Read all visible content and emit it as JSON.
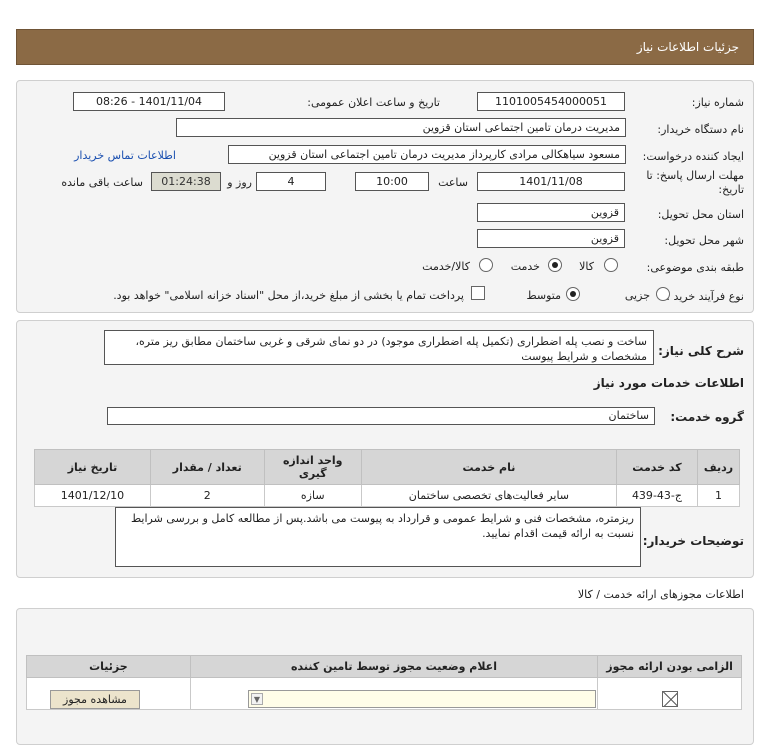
{
  "header": {
    "title": "جزئیات اطلاعات نیاز"
  },
  "need": {
    "number_label": "شماره نیاز:",
    "number": "1101005454000051",
    "announce_label": "تاریخ و ساعت اعلان عمومی:",
    "announce_value": "1401/11/04 - 08:26",
    "buyer_label": "نام دستگاه خریدار:",
    "buyer_value": "مدیریت درمان تامین اجتماعی استان قزوین",
    "creator_label": "ایجاد کننده درخواست:",
    "creator_value": "مسعود سیاهکالی مرادی کارپرداز مدیریت درمان تامین اجتماعی استان قزوین",
    "contact_link": "اطلاعات تماس خریدار",
    "deadline_label_1": "مهلت ارسال پاسخ: تا",
    "deadline_label_2": "تاریخ:",
    "deadline_date": "1401/11/08",
    "time_label": "ساعت",
    "deadline_time": "10:00",
    "days_value": "4",
    "days_label": "روز و",
    "remaining_time": "01:24:38",
    "remaining_label": "ساعت باقی مانده",
    "province_label": "استان محل تحویل:",
    "province_value": "قزوین",
    "city_label": "شهر محل تحویل:",
    "city_value": "قزوین",
    "category_label": "طبقه بندی موضوعی:",
    "category_options": [
      "کالا",
      "خدمت",
      "کالا/خدمت"
    ],
    "category_selected": 1,
    "process_label": "نوع فرآیند خرید :",
    "process_options": [
      "جزیی",
      "متوسط"
    ],
    "process_selected": 1,
    "payment_note": "پرداخت تمام یا بخشی از مبلغ خرید،از محل \"اسناد خزانه اسلامی\" خواهد بود."
  },
  "details": {
    "description_label": "شرح کلی نیاز:",
    "description": "ساخت و نصب پله اضطراری (تکمیل پله اضطراری موجود) در دو نمای شرقی و غربی ساختمان مطابق ریز متره، مشخصات و شرایط پیوست",
    "services_title": "اطلاعات خدمات مورد نیاز",
    "service_group_label": "گروه خدمت:",
    "service_group_value": "ساختمان",
    "table": {
      "headers": [
        "ردیف",
        "کد خدمت",
        "نام خدمت",
        "واحد اندازه گیری",
        "تعداد / مقدار",
        "تاریخ نیاز"
      ],
      "rows": [
        [
          "1",
          "ج-43-439",
          "سایر فعالیت‌های تخصصی ساختمان",
          "سازه",
          "2",
          "1401/12/10"
        ]
      ]
    },
    "buyer_notes_label": "توضیحات خریدار:",
    "buyer_notes": "ریزمتره، مشخصات فنی و شرایط عمومی و قرارداد به پیوست می باشد.پس از مطالعه کامل و بررسی شرایط نسبت به ارائه قیمت اقدام نمایید."
  },
  "licenses": {
    "title": "اطلاعات مجوزهای ارائه خدمت / کالا",
    "headers": [
      "الزامی بودن ارائه مجوز",
      "اعلام وضعیت مجوز توسط تامین کننده",
      "جزئیات"
    ],
    "view_button": "مشاهده مجوز"
  }
}
